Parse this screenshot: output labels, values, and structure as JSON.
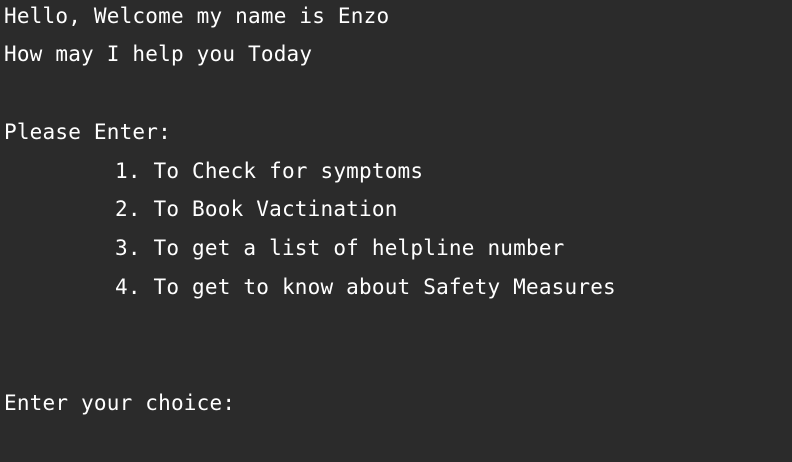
{
  "console": {
    "greeting": "Hello, Welcome my name is Enzo",
    "help_prompt": "How may I help you Today",
    "enter_prompt": "Please Enter:",
    "options": [
      "1. To Check for symptoms",
      "2. To Book Vactination",
      "3. To get a list of helpline number",
      "4. To get to know about Safety Measures"
    ],
    "choice_prompt": "Enter your choice:",
    "colors": {
      "background": "#2b2b2b",
      "text": "#ffffff"
    }
  }
}
